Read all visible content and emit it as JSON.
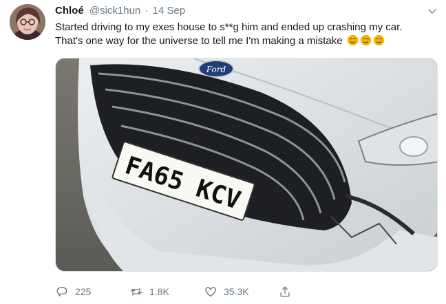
{
  "tweet": {
    "author_name": "Chloé",
    "author_handle": "@sick1hun",
    "separator": "·",
    "date": "14 Sep",
    "text_line1": "Started driving to my exes house to s**g him and ended up crashing my car.",
    "text_line2": "That's one way for the universe to tell me I'm making a mistake",
    "emoji_icons": [
      "relieved-face-icon",
      "relieved-face-icon",
      "relieved-face-icon"
    ]
  },
  "media": {
    "license_plate": "FA65 KCV",
    "car_brand": "Ford"
  },
  "actions": {
    "reply_count": "225",
    "retweet_count": "1.8K",
    "like_count": "35.3K"
  },
  "colors": {
    "text": "#14171a",
    "secondary": "#657786",
    "border": "#d9e1e6",
    "emoji": "#f5b400"
  }
}
